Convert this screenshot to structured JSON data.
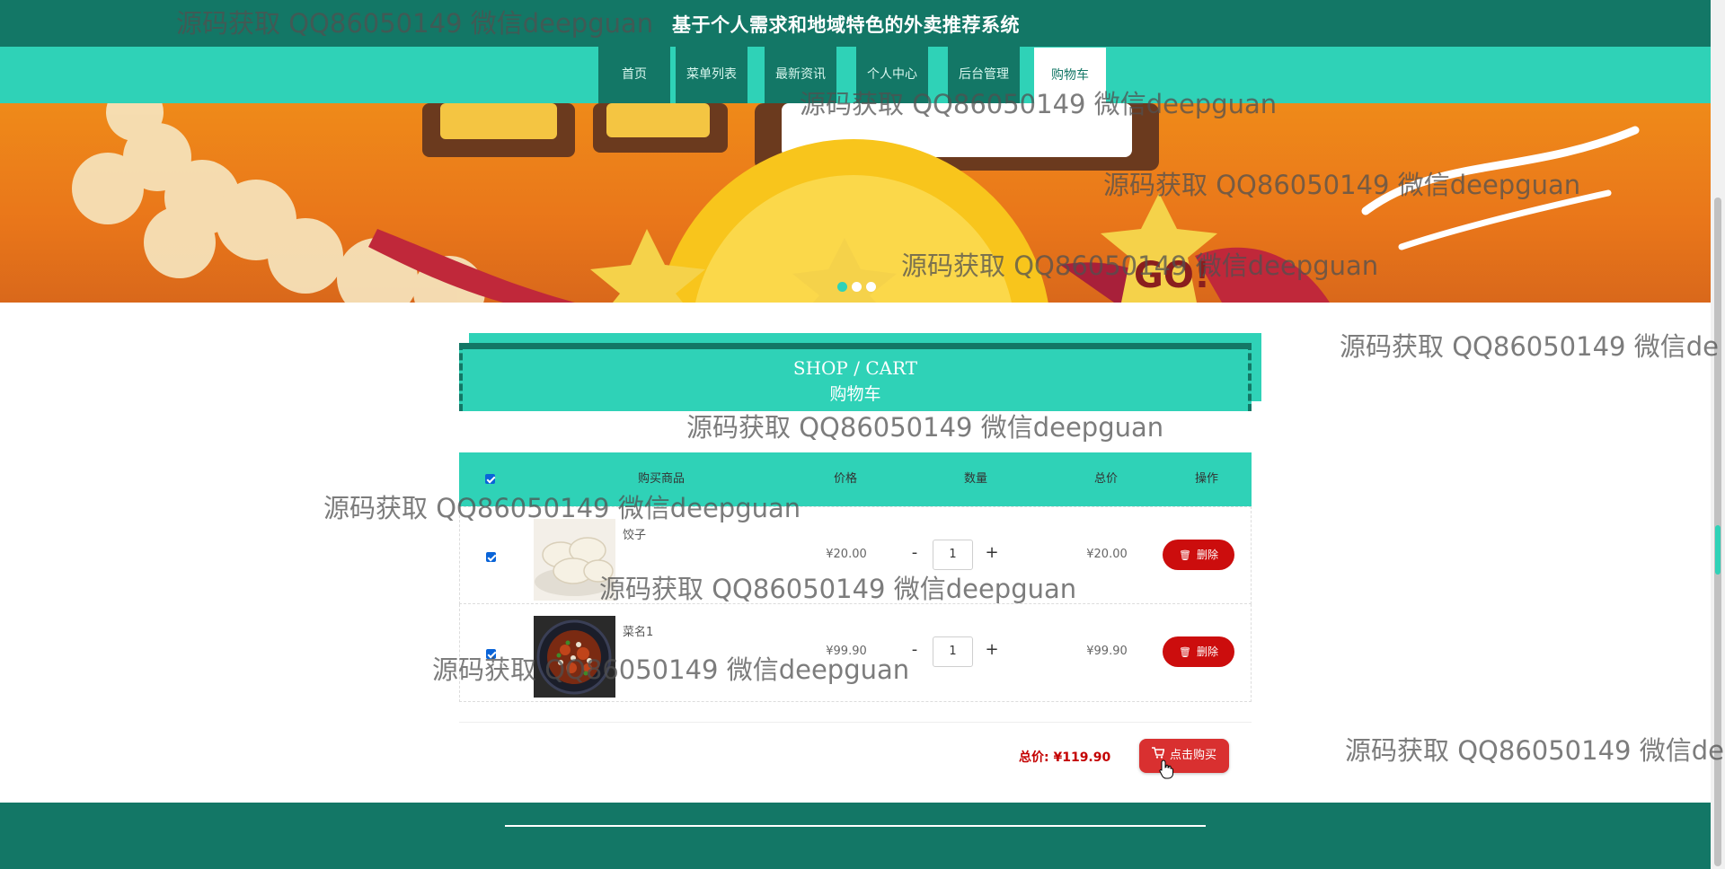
{
  "header": {
    "title": "基于个人需求和地域特色的外卖推荐系统"
  },
  "nav": {
    "items": [
      {
        "label": "首页"
      },
      {
        "label": "菜单列表"
      },
      {
        "label": "最新资讯"
      },
      {
        "label": "个人中心"
      },
      {
        "label": "后台管理"
      },
      {
        "label": "购物车"
      }
    ],
    "active_index": 5
  },
  "banner": {
    "slide_count": 3,
    "active_slide": 0
  },
  "section": {
    "title_en": "SHOP / CART",
    "title_cn": "购物车"
  },
  "cart": {
    "columns": [
      "购买商品",
      "价格",
      "数量",
      "总价",
      "操作"
    ],
    "select_all_checked": true,
    "items": [
      {
        "name": "饺子",
        "price": "¥20.00",
        "quantity": "1",
        "total": "¥20.00",
        "checked": true,
        "delete_label": "删除",
        "image_icon": "dumplings-image"
      },
      {
        "name": "菜名1",
        "price": "¥99.90",
        "quantity": "1",
        "total": "¥99.90",
        "checked": true,
        "delete_label": "删除",
        "image_icon": "stir-fry-dish-image"
      }
    ],
    "minus_symbol": "-",
    "plus_symbol": "+",
    "total_label": "总价: ¥119.90",
    "buy_label": "点击购买"
  },
  "watermark": {
    "text": "源码获取 QQ86050149 微信deepguan",
    "text_cut": "源码获取 QQ86050149 微信de"
  },
  "colors": {
    "dark_teal": "#137766",
    "teal": "#2fd2b7",
    "red": "#cc0d0d"
  }
}
